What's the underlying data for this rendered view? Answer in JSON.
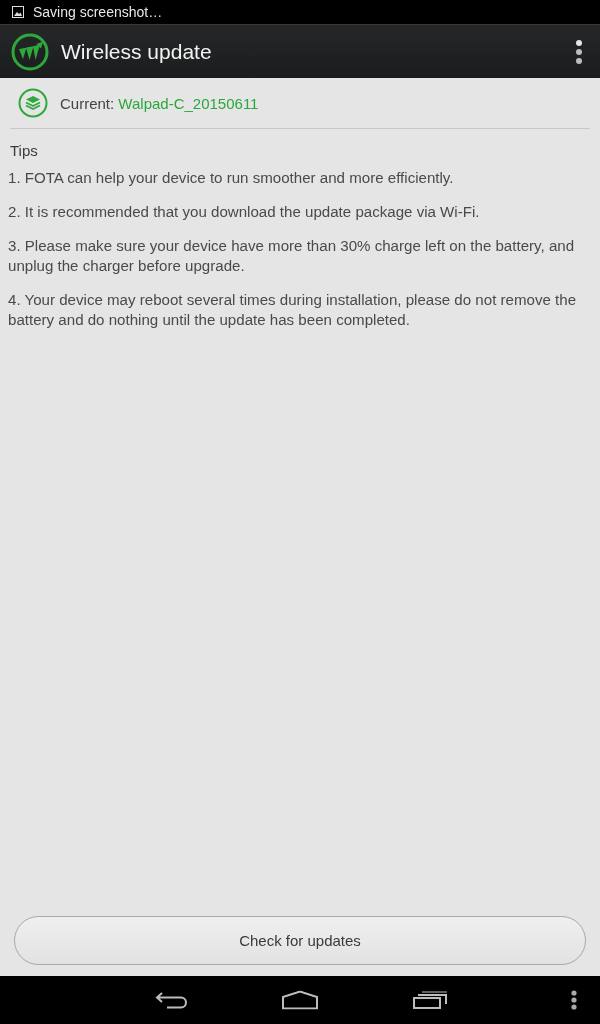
{
  "status_bar": {
    "notification": "Saving screenshot…"
  },
  "action_bar": {
    "title": "Wireless update"
  },
  "current": {
    "label": "Current:",
    "value": "Walpad-C_20150611"
  },
  "tips": {
    "heading": "Tips",
    "items": [
      "1. FOTA can help your device to run smoother and more efficiently.",
      "2. It is recommended that you download the update package via Wi-Fi.",
      "3. Please make sure your device have more than 30% charge left on the battery, and unplug the charger before upgrade.",
      "4. Your device may reboot several times during installation, please do not remove the battery and do nothing until the update has been completed."
    ]
  },
  "button": {
    "label": "Check for updates"
  }
}
